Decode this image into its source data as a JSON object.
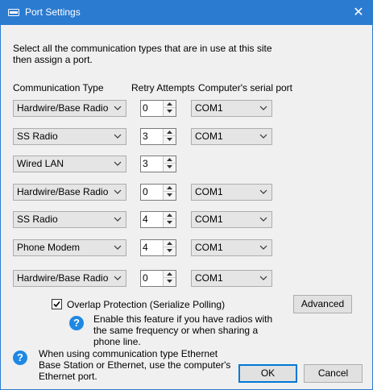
{
  "window": {
    "title": "Port Settings",
    "close_glyph": "✕"
  },
  "intro": "Select all the communication types that are in use at this site then assign a port.",
  "headers": {
    "comm_type": "Communication Type",
    "retry": "Retry Attempts",
    "serial_port": "Computer's serial port"
  },
  "rows": [
    {
      "type": "Hardwire/Base Radio",
      "retry": "0",
      "port": "COM1"
    },
    {
      "type": "SS Radio",
      "retry": "3",
      "port": "COM1"
    },
    {
      "type": "Wired LAN",
      "retry": "3",
      "port": null
    },
    {
      "type": "Hardwire/Base Radio",
      "retry": "0",
      "port": "COM1"
    },
    {
      "type": "SS Radio",
      "retry": "4",
      "port": "COM1"
    },
    {
      "type": "Phone Modem",
      "retry": "4",
      "port": "COM1"
    },
    {
      "type": "Hardwire/Base Radio",
      "retry": "0",
      "port": "COM1"
    }
  ],
  "overlap": {
    "label": "Overlap Protection (Serialize Polling)",
    "checked": true,
    "help_text": "Enable this feature if you have radios with the same frequency or when sharing a phone line."
  },
  "advanced_label": "Advanced",
  "ethernet_note": "When using communication type Ethernet Base Station or Ethernet, use the computer's Ethernet port.",
  "ok_label": "OK",
  "cancel_label": "Cancel",
  "icons": {
    "window": "window-icon",
    "help": "help-icon",
    "close": "close-icon"
  },
  "colors": {
    "titlebar": "#2b7bd1",
    "help": "#1e88e5"
  }
}
